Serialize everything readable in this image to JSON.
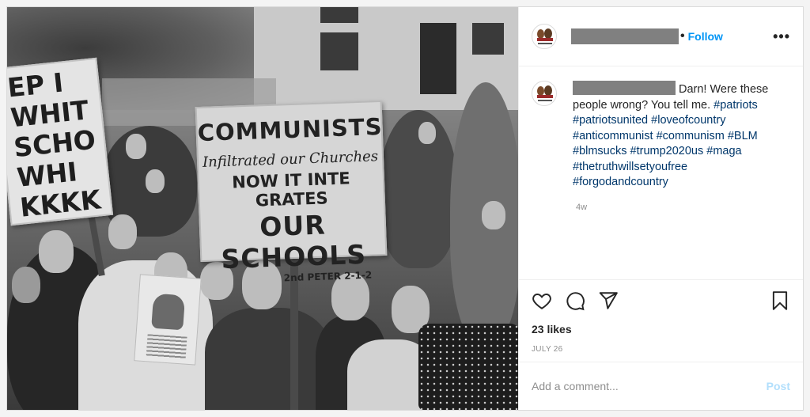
{
  "photo": {
    "sign_main": {
      "line1": "COMMUNISTS",
      "line2": "Infiltrated our Churches",
      "line3": "NOW IT INTE GRATES",
      "line4": "OUR SCHOOLS",
      "line5": "2nd PETER 2-1-2"
    },
    "sign_left": [
      "EP I",
      "WHIT",
      "SCHO",
      "WHI",
      "KKKK"
    ]
  },
  "header": {
    "dot": "•",
    "follow_label": "Follow",
    "more_label": "•••"
  },
  "caption": {
    "text": "Darn! Were these people wrong? You tell me.",
    "hashtags": [
      "#patriots",
      "#patriotsunited",
      "#loveofcountry",
      "#anticommunist",
      "#communism",
      "#BLM",
      "#blmsucks",
      "#trump2020us",
      "#maga",
      "#thetruthwillsetyoufree",
      "#forgodandcountry"
    ],
    "time": "4w"
  },
  "icons": {
    "like": "heart-icon",
    "comment": "comment-bubble-icon",
    "share": "paper-plane-icon",
    "save": "bookmark-icon"
  },
  "likes": "23 likes",
  "date": "JULY 26",
  "comment_box": {
    "placeholder": "Add a comment...",
    "post_label": "Post"
  },
  "colors": {
    "follow": "#0095f6",
    "hashtag": "#00376b",
    "post_disabled": "#b2dffc"
  }
}
